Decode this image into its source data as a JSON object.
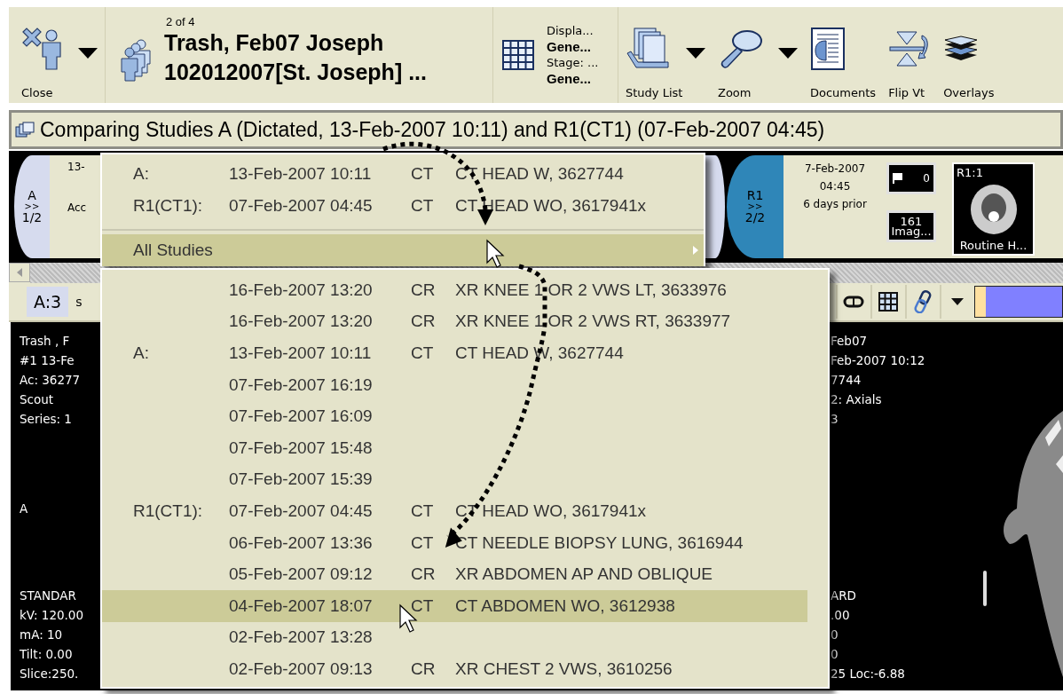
{
  "toolbar": {
    "close": {
      "label": "Close"
    },
    "patient": {
      "counter": "2 of 4",
      "name": "Trash, Feb07 Joseph",
      "id": "102012007[St. Joseph] ..."
    },
    "display": {
      "display_label": "Displa...",
      "display_value": "Gene...",
      "stage_label": "Stage: ...",
      "stage_value": "Gene..."
    },
    "tools": [
      {
        "kind": "study-list",
        "label": "Study List",
        "dropdown": true
      },
      {
        "kind": "zoom",
        "label": "Zoom",
        "dropdown": true
      },
      {
        "kind": "documents",
        "label": "Documents",
        "dropdown": false
      },
      {
        "kind": "flip",
        "label": "Flip Vt",
        "dropdown": false
      },
      {
        "kind": "overlays",
        "label": "Overlays",
        "dropdown": false
      }
    ]
  },
  "comparison_bar": {
    "text": "Comparing Studies A (Dictated, 13-Feb-2007 10:11) and R1(CT1) (07-Feb-2007 04:45)"
  },
  "study_strip": {
    "left": {
      "tab": "A",
      "arrows": ">>",
      "page": "1/2",
      "date": "13-",
      "accession": "Acc"
    },
    "right": {
      "tab": "R1",
      "arrows": ">>",
      "page": "2/2",
      "date": "7-Feb-2007",
      "time": "04:45",
      "relative": "6 days prior",
      "flag_count": "0",
      "image_count": "161",
      "image_label": "Imag...",
      "thumbnail_label": "R1:1",
      "thumbnail_caption": "Routine H..."
    }
  },
  "viewer_toolbar": {
    "series_tab": "A:3",
    "series_label": "s",
    "buttons": [
      {
        "kind": "loop"
      },
      {
        "kind": "grid"
      },
      {
        "kind": "link"
      },
      {
        "kind": "dropdown"
      }
    ]
  },
  "left_overlay": {
    "top_lines": [
      "Trash ,  F",
      "#1  13-Fe",
      "Ac: 36277",
      "Scout",
      "Series: 1"
    ],
    "marker": "A",
    "bottom_lines": [
      "STANDAR",
      "kV: 120.00",
      "mA: 10",
      "Tilt: 0.00",
      "Slice:250."
    ]
  },
  "right_overlay": {
    "top_lines": [
      "Feb07",
      "Feb-2007  10:12",
      "7744",
      "2: Axials",
      "3"
    ],
    "bottom_lines": [
      "ARD",
      ".00",
      "0",
      "0",
      "25   Loc:-6.88"
    ]
  },
  "context_menu": {
    "items": [
      {
        "label": "A:",
        "date": "13-Feb-2007 10:11",
        "modality": "CT",
        "description": "CT HEAD W, 3627744"
      },
      {
        "label": "R1(CT1):",
        "date": "07-Feb-2007 04:45",
        "modality": "CT",
        "description": "CT HEAD WO, 3617941x"
      }
    ],
    "submenu_item": {
      "label": "All Studies",
      "selected": true
    }
  },
  "all_studies_menu": {
    "items": [
      {
        "date": "16-Feb-2007 13:20",
        "modality": "CR",
        "description": "XR KNEE 1 OR 2 VWS LT, 3633976",
        "selected": false
      },
      {
        "date": "16-Feb-2007 13:20",
        "modality": "CR",
        "description": "XR KNEE 1 OR 2 VWS RT, 3633977",
        "selected": false
      },
      {
        "label": "A:",
        "date": "13-Feb-2007 10:11",
        "modality": "CT",
        "description": "CT HEAD W, 3627744",
        "selected": false
      },
      {
        "date": "07-Feb-2007 16:19",
        "selected": false
      },
      {
        "date": "07-Feb-2007 16:09",
        "selected": false
      },
      {
        "date": "07-Feb-2007 15:48",
        "selected": false
      },
      {
        "date": "07-Feb-2007 15:39",
        "selected": false
      },
      {
        "label": "R1(CT1):",
        "date": "07-Feb-2007 04:45",
        "modality": "CT",
        "description": "CT HEAD WO, 3617941x",
        "selected": false
      },
      {
        "date": "06-Feb-2007 13:36",
        "modality": "CT",
        "description": "CT NEEDLE BIOPSY LUNG, 3616944",
        "selected": false
      },
      {
        "date": "05-Feb-2007 09:12",
        "modality": "CR",
        "description": "XR ABDOMEN AP AND OBLIQUE",
        "selected": false
      },
      {
        "date": "04-Feb-2007 18:07",
        "modality": "CT",
        "description": "CT ABDOMEN WO, 3612938",
        "selected": true
      },
      {
        "date": "02-Feb-2007 13:28",
        "selected": false
      },
      {
        "date": "02-Feb-2007 09:13",
        "modality": "CR",
        "description": "XR CHEST 2 VWS, 3610256",
        "selected": false
      }
    ]
  }
}
